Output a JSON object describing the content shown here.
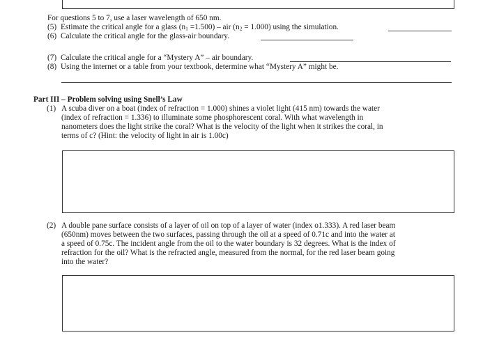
{
  "intro": "For questions 5 to 7, use a laser wavelength of 650 nm.",
  "questions_part2": [
    {
      "number": "(5)",
      "text_pre": "Estimate the critical angle for a glass (n",
      "sub1": "1",
      "text_mid": " =1.500) – air (n",
      "sub2": "2",
      "text_post": " = 1.000) using the simulation."
    },
    {
      "number": "(6)",
      "text": "Calculate the critical angle for the glass-air boundary."
    },
    {
      "number": "(7)",
      "text": "Calculate the critical angle for a “Mystery A” – air boundary."
    },
    {
      "number": "(8)",
      "text": "Using the internet or a table from your textbook, determine what “Mystery A” might be."
    }
  ],
  "part3": {
    "heading": "Part III – Problem solving using Snell’s Law",
    "problems": [
      {
        "number": "(1)",
        "lines": [
          "A scuba diver on a boat (index of refraction = 1.000) shines a violet light (415 nm) towards the water",
          "(index of refraction = 1.336) to illuminate some phosphorescent coral. With what wavelength in",
          "nanometers does the light strike the coral? What is the velocity of the light when it strikes the coral, in",
          "terms of c? (Hint: the velocity of light in air is 1.00c)"
        ]
      },
      {
        "number": "(2)",
        "lines": [
          "A double pane surface consists of a layer of oil on top of a layer of water (index o1.333). A red laser beam",
          "(650nm) moves between the two surfaces, passing through the oil at a speed of 0.71c and into the water at",
          "a speed of 0.75c. The incident angle from the oil to the water boundary is 32 degrees. What is the index of",
          "refraction for the oil? What is the refracted angle, measured from the normal, for the red laser beam going",
          "into the water?"
        ]
      }
    ]
  }
}
